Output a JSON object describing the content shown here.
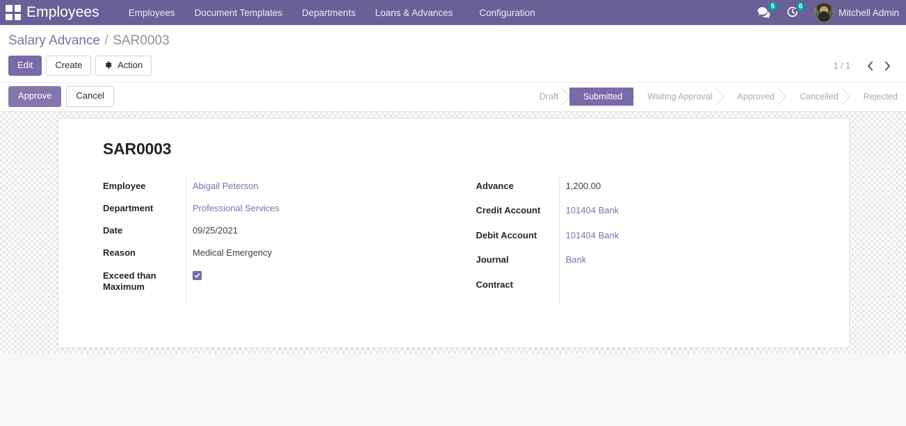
{
  "navbar": {
    "apps_icon": "apps-grid-icon",
    "brand": "Employees",
    "menu": [
      {
        "label": "Employees"
      },
      {
        "label": "Document Templates"
      },
      {
        "label": "Departments"
      },
      {
        "label": "Loans & Advances"
      },
      {
        "label": "Configuration"
      }
    ],
    "messages_icon": "chat-bubble-icon",
    "messages_count": "5",
    "activities_icon": "clock-activity-icon",
    "activities_count": "6",
    "avatar_icon": "user-avatar",
    "user_name": "Mitchell Admin",
    "brand_color": "#6b5f97",
    "badge_color": "#00a09d"
  },
  "breadcrumb": {
    "root": "Salary Advance",
    "separator": "/",
    "current": "SAR0003"
  },
  "toolbar": {
    "edit_label": "Edit",
    "create_label": "Create",
    "action_label": "Action",
    "action_icon": "gear-icon"
  },
  "pager": {
    "count": "1 / 1",
    "prev_icon": "chevron-left-icon",
    "next_icon": "chevron-right-icon"
  },
  "workflow": {
    "approve_label": "Approve",
    "cancel_label": "Cancel",
    "stages": [
      {
        "label": "Draft",
        "active": false
      },
      {
        "label": "Submitted",
        "active": true
      },
      {
        "label": "Waiting Approval",
        "active": false
      },
      {
        "label": "Approved",
        "active": false
      },
      {
        "label": "Cancelled",
        "active": false
      },
      {
        "label": "Rejected",
        "active": false
      }
    ],
    "active_color": "#7a6aa8"
  },
  "record": {
    "title": "SAR0003",
    "left_fields": [
      {
        "label": "Employee",
        "value": "Abigail Peterson",
        "type": "link"
      },
      {
        "label": "Department",
        "value": "Professional Services",
        "type": "link"
      },
      {
        "label": "Date",
        "value": "09/25/2021",
        "type": "text"
      },
      {
        "label": "Reason",
        "value": "Medical Emergency",
        "type": "text"
      },
      {
        "label": "Exceed than Maximum",
        "value": "",
        "type": "checkbox",
        "checked": true
      }
    ],
    "right_fields": [
      {
        "label": "Advance",
        "value": "1,200.00",
        "type": "text"
      },
      {
        "label": "Credit Account",
        "value": "101404 Bank",
        "type": "link"
      },
      {
        "label": "Debit Account",
        "value": "101404 Bank",
        "type": "link"
      },
      {
        "label": "Journal",
        "value": "Bank",
        "type": "link"
      },
      {
        "label": "Contract",
        "value": "",
        "type": "text"
      }
    ]
  }
}
